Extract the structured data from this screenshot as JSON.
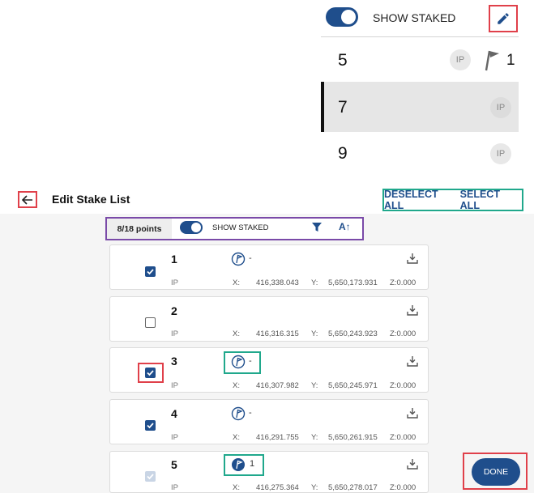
{
  "zoom_panel": {
    "show_staked_label": "SHOW STAKED",
    "rows": [
      {
        "number": "5",
        "type_badge": "IP",
        "flag_count": "1"
      },
      {
        "number": "7",
        "type_badge": "IP"
      },
      {
        "number": "9",
        "type_badge": "IP"
      }
    ]
  },
  "header": {
    "title": "Edit Stake List",
    "deselect_all": "DESELECT ALL",
    "select_all": "SELECT ALL"
  },
  "filter_bar": {
    "count": "8/18 points",
    "show_staked_label": "SHOW STAKED",
    "sort_label": "A↑"
  },
  "points": [
    {
      "number": "1",
      "type": "IP",
      "x_label": "X:",
      "x": "416,338.043",
      "y_label": "Y:",
      "y": "5,650,173.931",
      "z": "Z:0.000",
      "checked": true,
      "flag_text": "-"
    },
    {
      "number": "2",
      "type": "IP",
      "x_label": "X:",
      "x": "416,316.315",
      "y_label": "Y:",
      "y": "5,650,243.923",
      "z": "Z:0.000",
      "checked": false,
      "flag_text": ""
    },
    {
      "number": "3",
      "type": "IP",
      "x_label": "X:",
      "x": "416,307.982",
      "y_label": "Y:",
      "y": "5,650,245.971",
      "z": "Z:0.000",
      "checked": true,
      "flag_text": "-"
    },
    {
      "number": "4",
      "type": "IP",
      "x_label": "X:",
      "x": "416,291.755",
      "y_label": "Y:",
      "y": "5,650,261.915",
      "z": "Z:0.000",
      "checked": true,
      "flag_text": "-"
    },
    {
      "number": "5",
      "type": "IP",
      "x_label": "X:",
      "x": "416,275.364",
      "y_label": "Y:",
      "y": "5,650,278.017",
      "z": "Z:0.000",
      "checked": true,
      "flag_text": "1"
    }
  ],
  "done_label": "DONE",
  "colors": {
    "accent": "#1f4e8c",
    "highlight_red": "#e0404a",
    "highlight_teal": "#20a88c",
    "highlight_purple": "#7a4aa8"
  }
}
